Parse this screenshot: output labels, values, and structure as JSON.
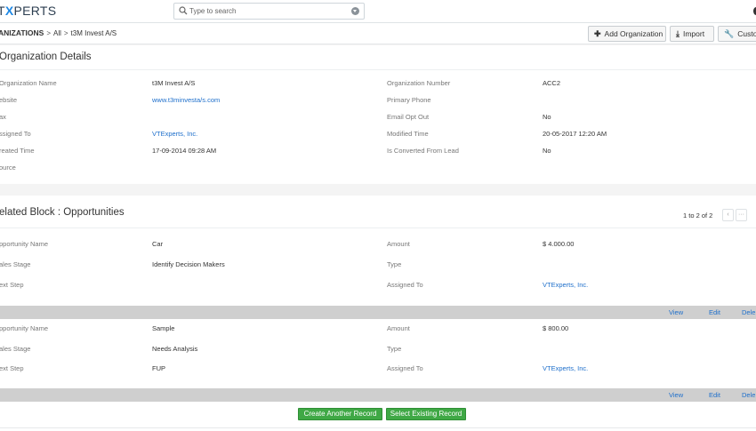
{
  "header": {
    "logo_prefix": "T",
    "logo_x": "X",
    "logo_suffix": "PERTS",
    "search_placeholder": "Type to search"
  },
  "breadcrumb": {
    "module": "anizations",
    "filter": "All",
    "record": "t3M Invest A/S"
  },
  "toolbar": {
    "add_label": "Add Organization",
    "import_label": "Import",
    "customize_label": "Custom"
  },
  "details": {
    "title": "Organization Details",
    "left": [
      {
        "label": "Organization Name",
        "value": "t3M Invest A/S",
        "link": false
      },
      {
        "label": "ebsite",
        "value": "www.t3minvesta/s.com",
        "link": true
      },
      {
        "label": "ax",
        "value": "",
        "link": false
      },
      {
        "label": "ssigned To",
        "value": "VTExperts, Inc.",
        "link": true
      },
      {
        "label": "reated Time",
        "value": "17-09-2014 09:28 AM",
        "link": false
      },
      {
        "label": "ource",
        "value": "",
        "link": false
      }
    ],
    "right": [
      {
        "label": "Organization Number",
        "value": "ACC2",
        "link": false
      },
      {
        "label": "Primary Phone",
        "value": "",
        "link": false
      },
      {
        "label": "Email Opt Out",
        "value": "No",
        "link": false
      },
      {
        "label": "Modified Time",
        "value": "20-05-2017 12:20 AM",
        "link": false
      },
      {
        "label": "Is Converted From Lead",
        "value": "No",
        "link": false
      }
    ]
  },
  "related": {
    "title": "elated Block : Opportunities",
    "pager_text": "1 to 2 of 2",
    "prev": "‹",
    "more": "···",
    "records": [
      {
        "left": [
          {
            "label": "pportunity Name",
            "value": "Car"
          },
          {
            "label": "ales Stage",
            "value": "Identify Decision Makers"
          },
          {
            "label": "ext Step",
            "value": ""
          }
        ],
        "right": [
          {
            "label": "Amount",
            "value": "$ 4.000.00",
            "link": false
          },
          {
            "label": "Type",
            "value": "",
            "link": false
          },
          {
            "label": "Assigned To",
            "value": "VTExperts, Inc.",
            "link": true
          }
        ]
      },
      {
        "left": [
          {
            "label": "pportunity Name",
            "value": "Sample"
          },
          {
            "label": "ales Stage",
            "value": "Needs Analysis"
          },
          {
            "label": "ext Step",
            "value": "FUP"
          }
        ],
        "right": [
          {
            "label": "Amount",
            "value": "$ 800.00",
            "link": false
          },
          {
            "label": "Type",
            "value": "",
            "link": false
          },
          {
            "label": "Assigned To",
            "value": "VTExperts, Inc.",
            "link": true
          }
        ]
      }
    ],
    "actions": {
      "view": "View",
      "edit": "Edit",
      "delete": "Dele"
    },
    "create_label": "Create Another Record",
    "select_label": "Select Existing Record"
  },
  "colors": {
    "accent": "#1e6fcb",
    "green": "#3fa845",
    "grey_bar": "#cfcfcf"
  }
}
